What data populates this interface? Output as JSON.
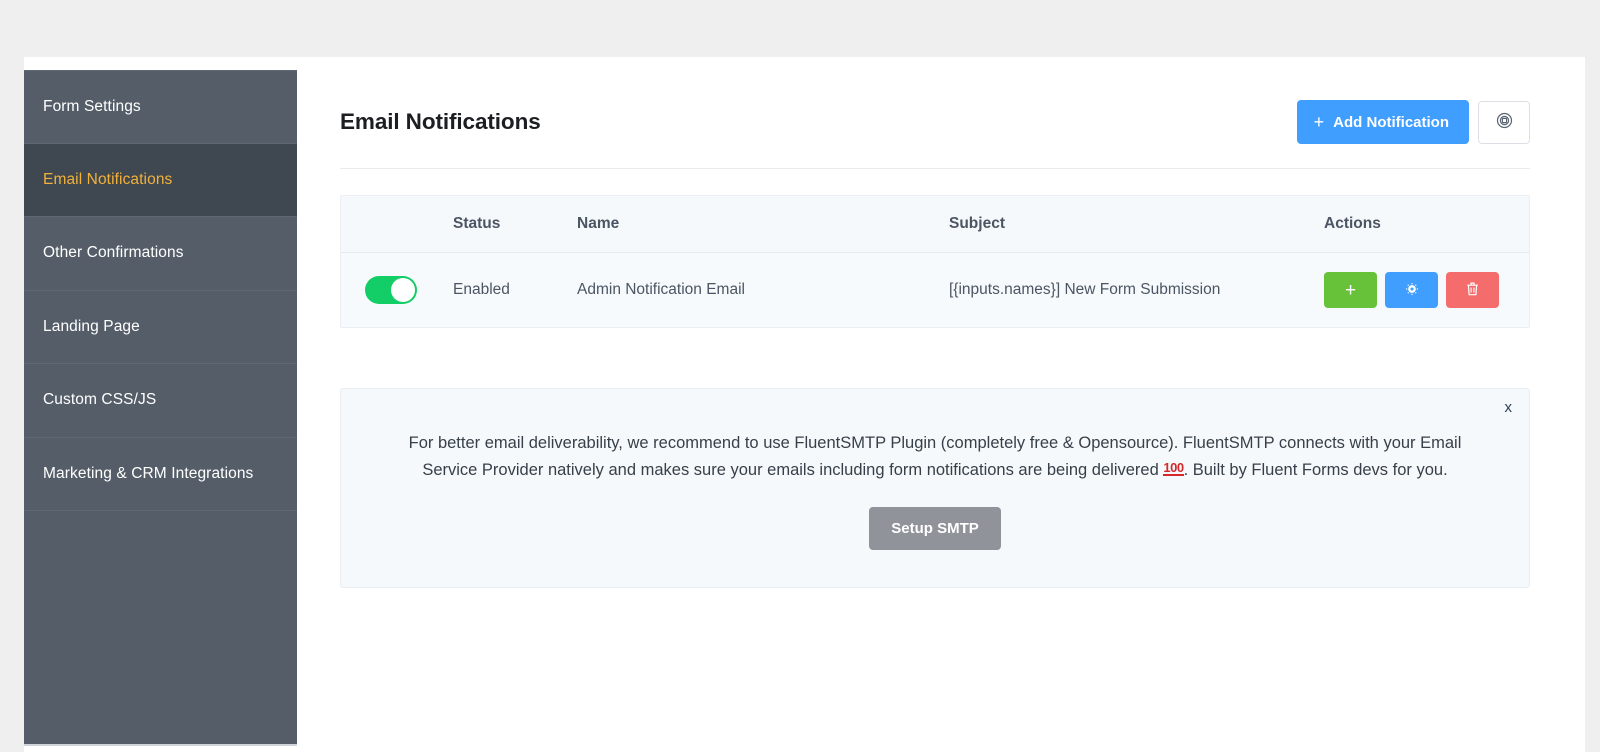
{
  "sidebar": {
    "items": [
      {
        "label": "Form Settings",
        "active": false
      },
      {
        "label": "Email Notifications",
        "active": true
      },
      {
        "label": "Other Confirmations",
        "active": false
      },
      {
        "label": "Landing Page",
        "active": false
      },
      {
        "label": "Custom CSS/JS",
        "active": false
      },
      {
        "label": "Marketing & CRM Integrations",
        "active": false
      }
    ]
  },
  "header": {
    "title": "Email Notifications",
    "add_button_label": "Add Notification",
    "add_button_icon": "plus-icon",
    "settings_button_icon": "target-settings-icon",
    "accent_color": "#409eff"
  },
  "table": {
    "columns": [
      "",
      "Status",
      "Name",
      "Subject",
      "Actions"
    ],
    "rows": [
      {
        "toggle_on": true,
        "status": "Enabled",
        "name": "Admin Notification Email",
        "subject": "[{inputs.names}] New Form Submission",
        "actions": [
          {
            "name": "duplicate-notification-button",
            "icon": "plus-icon",
            "glyph": "+",
            "color": "#67c23a"
          },
          {
            "name": "edit-notification-button",
            "icon": "gear-icon",
            "glyph": "⚙",
            "color": "#409eff"
          },
          {
            "name": "delete-notification-button",
            "icon": "trash-icon",
            "glyph": "Ὕ1",
            "color": "#f56c6c"
          }
        ]
      }
    ]
  },
  "notice": {
    "close_label": "x",
    "text_part1": "For better email deliverability, we recommend to use FluentSMTP Plugin (completely free & Opensource). FluentSMTP connects with your Email Service Provider natively and makes sure your emails including form notifications are being delivered ",
    "emoji": "100",
    "text_part2": ". Built by Fluent Forms devs for you.",
    "button_label": "Setup SMTP"
  }
}
